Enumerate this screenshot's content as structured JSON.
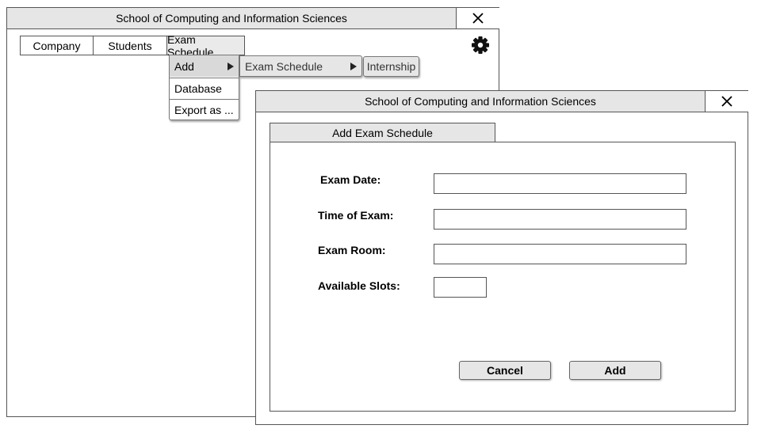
{
  "main_window": {
    "title": "School of Computing and Information Sciences",
    "close_icon": "close-icon",
    "tabs": [
      "Company",
      "Students",
      "Exam Schedule"
    ],
    "settings_icon": "gear-icon"
  },
  "menu": {
    "items": [
      "Add",
      "Database",
      "Export as ..."
    ],
    "submenu": {
      "label": "Exam Schedule"
    },
    "next_item": "Internship"
  },
  "dialog": {
    "title": "School of Computing and Information Sciences",
    "close_icon": "close-icon",
    "tab": "Add Exam Schedule",
    "fields": {
      "exam_date": {
        "label": "Exam Date:",
        "value": ""
      },
      "time_of_exam": {
        "label": "Time of Exam:",
        "value": ""
      },
      "exam_room": {
        "label": "Exam Room:",
        "value": ""
      },
      "available_slots": {
        "label": "Available Slots:",
        "value": ""
      }
    },
    "buttons": {
      "cancel": "Cancel",
      "add": "Add"
    }
  }
}
